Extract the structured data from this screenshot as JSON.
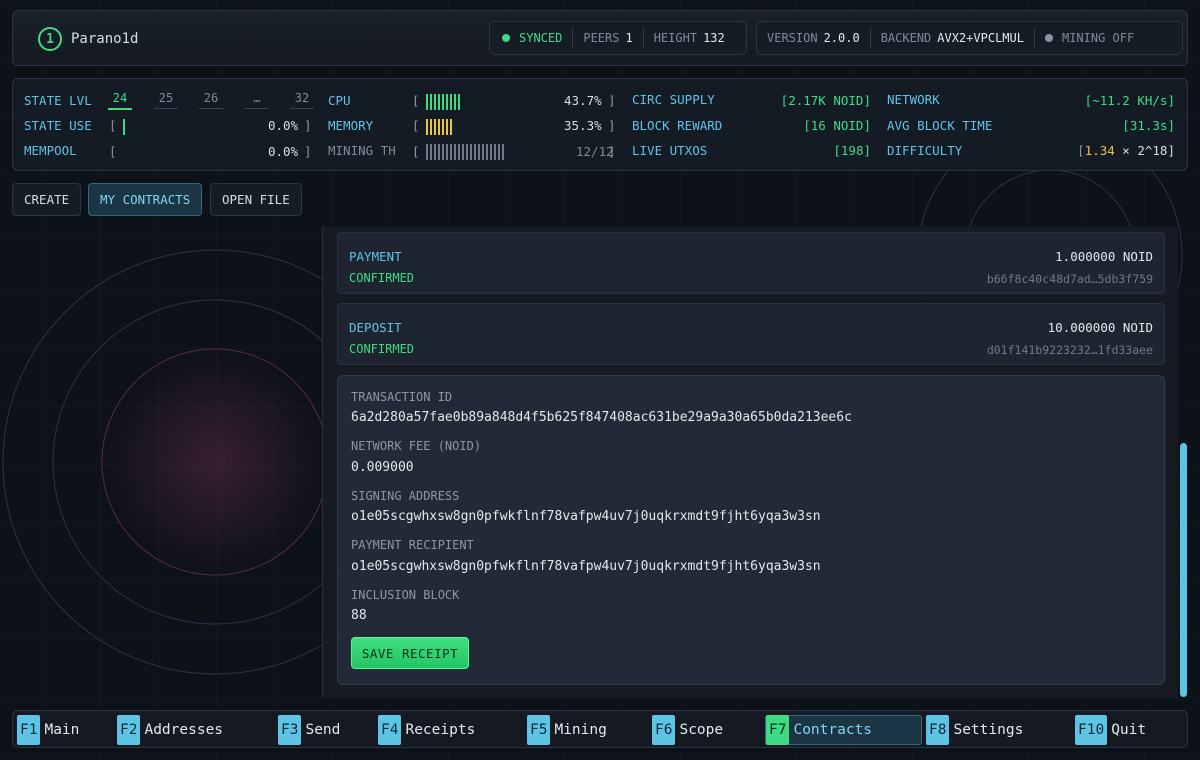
{
  "header": {
    "logo_glyph": "1",
    "app_name": "Parano1d",
    "sync_status": "SYNCED",
    "peers_label": "PEERS",
    "peers_value": "1",
    "height_label": "HEIGHT",
    "height_value": "132",
    "version_label": "VERSION",
    "version_value": "2.0.0",
    "backend_label": "BACKEND",
    "backend_value": "AVX2+VPCLMUL",
    "mining_status": "MINING OFF"
  },
  "stats": {
    "state_lvl_label": "STATE LVL",
    "state_levels": [
      "24",
      "25",
      "26",
      "…",
      "32"
    ],
    "state_use_label": "STATE USE",
    "state_use_pct": "0.0%",
    "mempool_label": "MEMPOOL",
    "mempool_pct": "0.0%",
    "cpu_label": "CPU",
    "cpu_pct": "43.7%",
    "cpu_fraction": 0.437,
    "memory_label": "MEMORY",
    "memory_pct": "35.3%",
    "memory_fraction": 0.353,
    "mining_th_label": "MINING TH",
    "mining_th_value": "12/12",
    "circ_supply_label": "CIRC SUPPLY",
    "circ_supply_value": "2.17K NOID",
    "block_reward_label": "BLOCK REWARD",
    "block_reward_value": "16 NOID",
    "live_utxos_label": "LIVE UTXOS",
    "live_utxos_value": "198",
    "network_label": "NETWORK",
    "network_value": "~11.2 KH/s",
    "avg_block_time_label": "AVG BLOCK TIME",
    "avg_block_time_value": "31.3s",
    "difficulty_label": "DIFFICULTY",
    "difficulty_mantissa": "1.34",
    "difficulty_exp": " × 2^18"
  },
  "toolbar": {
    "create_label": "CREATE",
    "my_contracts_label": "MY CONTRACTS",
    "open_file_label": "OPEN FILE"
  },
  "transactions": [
    {
      "type": "PAYMENT",
      "status": "CONFIRMED",
      "amount": "1.000000 NOID",
      "hash": "b66f8c40c48d7ad…5db3f759"
    },
    {
      "type": "DEPOSIT",
      "status": "CONFIRMED",
      "amount": "10.000000 NOID",
      "hash": "d01f141b9223232…1fd33aee"
    }
  ],
  "detail": {
    "txid_label": "TRANSACTION ID",
    "txid_value": "6a2d280a57fae0b89a848d4f5b625f847408ac631be29a9a30a65b0da213ee6c",
    "fee_label": "NETWORK FEE (NOID)",
    "fee_value": "0.009000",
    "signing_label": "SIGNING ADDRESS",
    "signing_value": "o1e05scgwhxsw8gn0pfwkflnf78vafpw4uv7j0uqkrxmdt9fjht6yqa3w3sn",
    "recipient_label": "PAYMENT RECIPIENT",
    "recipient_value": "o1e05scgwhxsw8gn0pfwkflnf78vafpw4uv7j0uqkrxmdt9fjht6yqa3w3sn",
    "block_label": "INCLUSION BLOCK",
    "block_value": "88",
    "save_label": "SAVE RECEIPT"
  },
  "footer": {
    "keys": [
      {
        "key": "F1",
        "name": "Main"
      },
      {
        "key": "F2",
        "name": "Addresses"
      },
      {
        "key": "F3",
        "name": "Send"
      },
      {
        "key": "F4",
        "name": "Receipts"
      },
      {
        "key": "F5",
        "name": "Mining"
      },
      {
        "key": "F6",
        "name": "Scope"
      },
      {
        "key": "F7",
        "name": "Contracts"
      },
      {
        "key": "F8",
        "name": "Settings"
      },
      {
        "key": "F10",
        "name": "Quit"
      }
    ],
    "active_index": 6
  },
  "colors": {
    "accent_green": "#3ddc84",
    "accent_cyan": "#5ec4e6",
    "accent_yellow": "#e8c547",
    "background": "#0d1118"
  }
}
